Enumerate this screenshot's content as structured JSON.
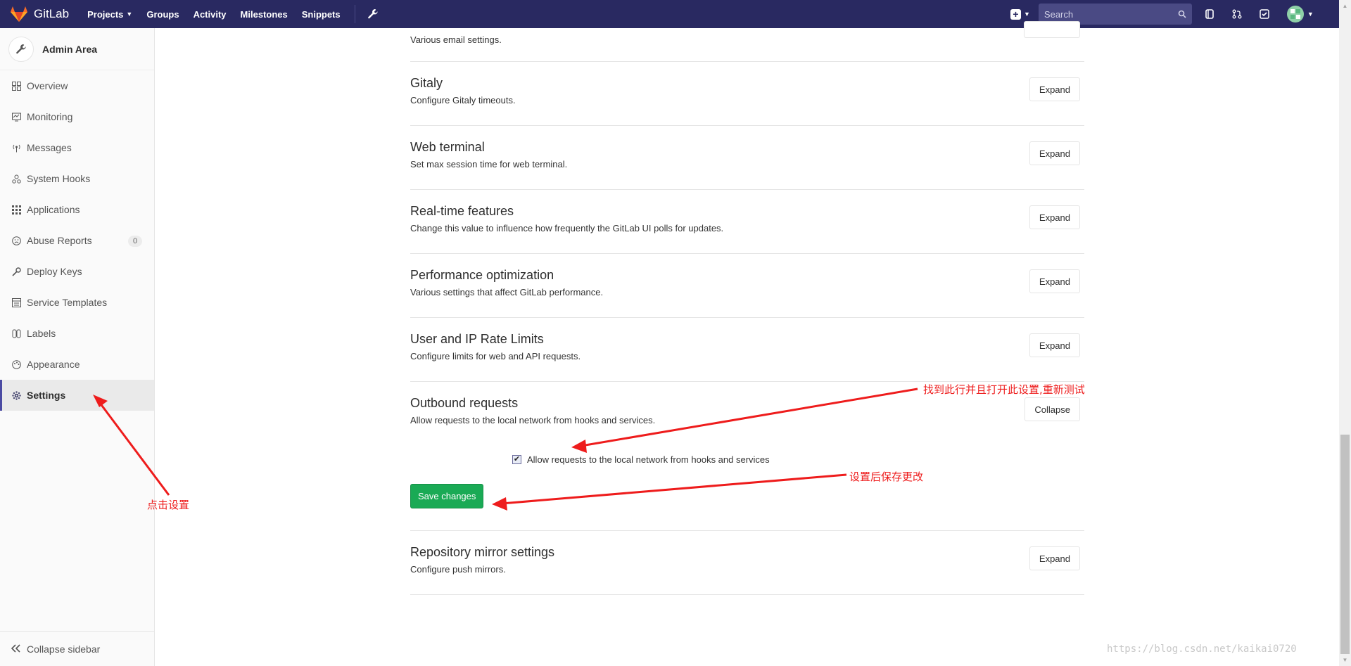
{
  "navbar": {
    "brand": "GitLab",
    "links": [
      {
        "label": "Projects",
        "has_dropdown": true
      },
      {
        "label": "Groups"
      },
      {
        "label": "Activity"
      },
      {
        "label": "Milestones"
      },
      {
        "label": "Snippets"
      }
    ],
    "search_placeholder": "Search"
  },
  "sidebar": {
    "title": "Admin Area",
    "items": [
      {
        "label": "Overview",
        "icon": "overview-icon"
      },
      {
        "label": "Monitoring",
        "icon": "monitoring-icon"
      },
      {
        "label": "Messages",
        "icon": "messages-icon"
      },
      {
        "label": "System Hooks",
        "icon": "hooks-icon"
      },
      {
        "label": "Applications",
        "icon": "applications-icon"
      },
      {
        "label": "Abuse Reports",
        "icon": "abuse-icon",
        "badge": "0"
      },
      {
        "label": "Deploy Keys",
        "icon": "key-icon"
      },
      {
        "label": "Service Templates",
        "icon": "templates-icon"
      },
      {
        "label": "Labels",
        "icon": "labels-icon"
      },
      {
        "label": "Appearance",
        "icon": "appearance-icon"
      },
      {
        "label": "Settings",
        "icon": "gear-icon",
        "active": true
      }
    ],
    "collapse_label": "Collapse sidebar"
  },
  "sections": {
    "email": {
      "desc": "Various email settings."
    },
    "gitaly": {
      "title": "Gitaly",
      "desc": "Configure Gitaly timeouts.",
      "button": "Expand"
    },
    "web_terminal": {
      "title": "Web terminal",
      "desc": "Set max session time for web terminal.",
      "button": "Expand"
    },
    "realtime": {
      "title": "Real-time features",
      "desc": "Change this value to influence how frequently the GitLab UI polls for updates.",
      "button": "Expand"
    },
    "performance": {
      "title": "Performance optimization",
      "desc": "Various settings that affect GitLab performance.",
      "button": "Expand"
    },
    "rate_limits": {
      "title": "User and IP Rate Limits",
      "desc": "Configure limits for web and API requests.",
      "button": "Expand"
    },
    "outbound": {
      "title": "Outbound requests",
      "desc": "Allow requests to the local network from hooks and services.",
      "button": "Collapse",
      "checkbox_label": "Allow requests to the local network from hooks and services",
      "checkbox_checked": true,
      "save_label": "Save changes"
    },
    "mirror": {
      "title": "Repository mirror settings",
      "desc": "Configure push mirrors.",
      "button": "Expand"
    }
  },
  "annotations": {
    "click_settings": "点击设置",
    "find_row": "找到此行并且打开此设置,重新测试",
    "save_after": "设置后保存更改"
  },
  "watermark": "https://blog.csdn.net/kaikai0720",
  "colors": {
    "navbar": "#292961",
    "save_button": "#1aaa55",
    "annotation": "#ee1c1c",
    "active_bar": "#4b4ba3"
  }
}
